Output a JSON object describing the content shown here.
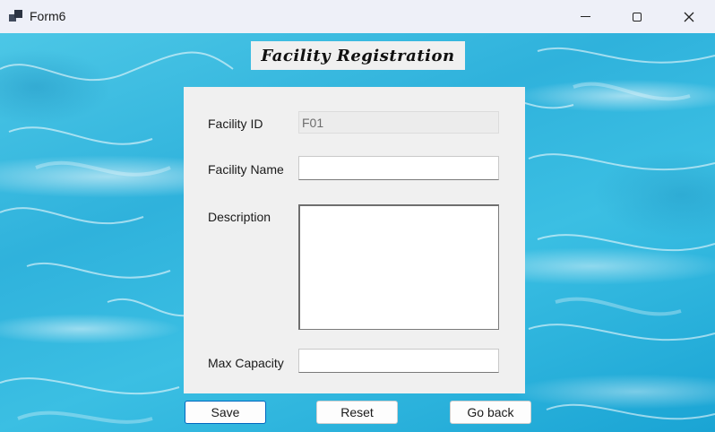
{
  "window": {
    "title": "Form6"
  },
  "form": {
    "heading": "Facility Registration",
    "fields": {
      "facility_id": {
        "label": "Facility ID",
        "value": "F01"
      },
      "facility_name": {
        "label": "Facility Name",
        "value": ""
      },
      "description": {
        "label": "Description",
        "value": ""
      },
      "max_capacity": {
        "label": "Max Capacity",
        "value": ""
      }
    }
  },
  "buttons": {
    "save": "Save",
    "reset": "Reset",
    "go_back": "Go back"
  },
  "icons": {
    "app": "form-window-icon",
    "minimize": "minimize-icon",
    "maximize": "maximize-icon",
    "close": "close-icon"
  },
  "colors": {
    "background_water": "#3bbfe3",
    "panel": "#f0f0f0",
    "default_button_border": "#0067c0"
  }
}
